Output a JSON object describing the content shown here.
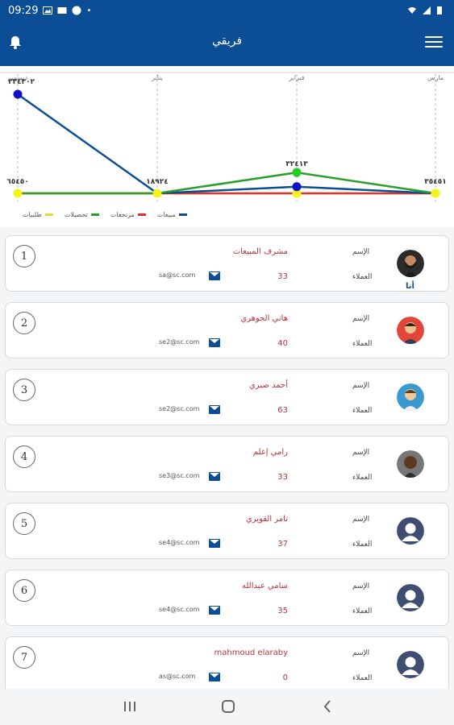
{
  "status_bar": {
    "time": "09:29",
    "battery_icon": "battery-icon",
    "signal_icon": "signal-icon",
    "wifi_icon": "wifi-icon"
  },
  "app_bar": {
    "title": "فريقي",
    "menu_icon": "menu-icon",
    "bell_icon": "bell-icon"
  },
  "chart_data": {
    "type": "line",
    "categories": [
      "مارس",
      "فبراير",
      "يناير",
      "ديسمبر"
    ],
    "category_positions": [
      "right",
      "center-right",
      "center-left",
      "left"
    ],
    "series": [
      {
        "name": "مبيعات",
        "color": "#0b4e96",
        "values": [
          0,
          35,
          0,
          524
        ]
      },
      {
        "name": "مرتجعات",
        "color": "#d33",
        "values": [
          0,
          0,
          0,
          0
        ]
      },
      {
        "name": "تحصيلات",
        "color": "#2a9d2a",
        "values": [
          0,
          110,
          0,
          0
        ]
      },
      {
        "name": "طلبيات",
        "color": "#f2d43a",
        "values": [
          0,
          0,
          0,
          0
        ]
      }
    ],
    "point_labels": [
      "٣٥٤٥١",
      "٣٢٤١٣",
      "١٨٩٢٤",
      "٢٣٤٣٠٢"
    ],
    "bottom_labels": [
      "٣٥٤٥١",
      "١٨٩٢٤",
      "٦٥٤٥٠"
    ]
  },
  "legend": [
    {
      "label": "طلبيات",
      "color": "#f2d43a"
    },
    {
      "label": "تحصيلات",
      "color": "#2a9d2a"
    },
    {
      "label": "مرتجعات",
      "color": "#d33"
    },
    {
      "label": "مبيعات",
      "color": "#0b4e96"
    }
  ],
  "labels": {
    "name": "الإسم",
    "clients": "العملاء",
    "you": "أنا"
  },
  "members": [
    {
      "rank": "1",
      "name": "مشرف المبيعات",
      "clients": "33",
      "email": "sa@sc.com",
      "avatar": "avatar-man-beard"
    },
    {
      "rank": "2",
      "name": "هاني الجوهري",
      "clients": "40",
      "email": "se2@sc.com",
      "avatar": "avatar-man-red"
    },
    {
      "rank": "3",
      "name": "أحمد صبري",
      "clients": "63",
      "email": "se2@sc.com",
      "avatar": "avatar-man-blue"
    },
    {
      "rank": "4",
      "name": "رامي إعلم",
      "clients": "33",
      "email": "se3@sc.com",
      "avatar": "avatar-man-dark"
    },
    {
      "rank": "5",
      "name": "تامر القويري",
      "clients": "37",
      "email": "se4@sc.com",
      "avatar": "avatar-placeholder"
    },
    {
      "rank": "6",
      "name": "سامي عبدالله",
      "clients": "35",
      "email": "se4@sc.com",
      "avatar": "avatar-placeholder"
    },
    {
      "rank": "7",
      "name": "mahmoud elaraby",
      "clients": "0",
      "email": "as@sc.com",
      "avatar": "avatar-placeholder"
    }
  ],
  "nav": {
    "recent_icon": "recents-icon",
    "home_icon": "home-icon",
    "back_icon": "back-icon"
  }
}
